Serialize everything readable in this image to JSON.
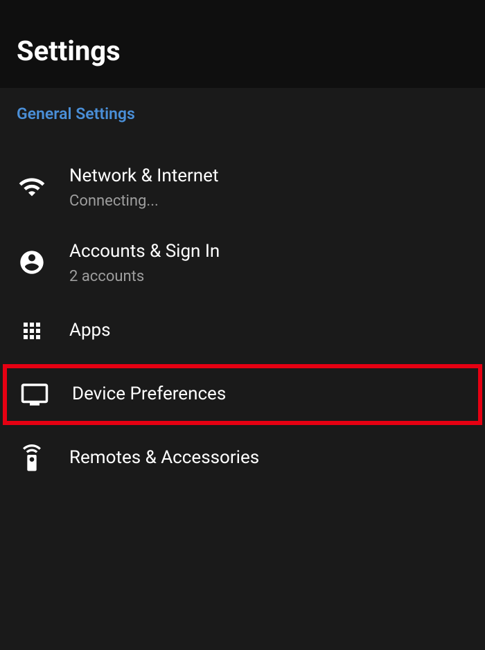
{
  "header": {
    "title": "Settings"
  },
  "section": {
    "title": "General Settings"
  },
  "items": [
    {
      "icon": "wifi-icon",
      "title": "Network & Internet",
      "subtitle": "Connecting...",
      "highlighted": false
    },
    {
      "icon": "account-icon",
      "title": "Accounts & Sign In",
      "subtitle": "2 accounts",
      "highlighted": false
    },
    {
      "icon": "apps-icon",
      "title": "Apps",
      "subtitle": null,
      "highlighted": false
    },
    {
      "icon": "tv-icon",
      "title": "Device Preferences",
      "subtitle": null,
      "highlighted": true
    },
    {
      "icon": "remote-icon",
      "title": "Remotes & Accessories",
      "subtitle": null,
      "highlighted": false
    }
  ]
}
